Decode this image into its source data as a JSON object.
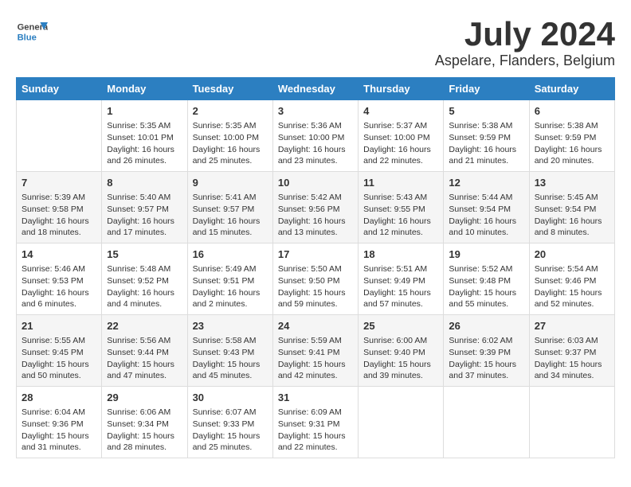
{
  "header": {
    "logo_general": "General",
    "logo_blue": "Blue",
    "month_year": "July 2024",
    "location": "Aspelare, Flanders, Belgium"
  },
  "weekdays": [
    "Sunday",
    "Monday",
    "Tuesday",
    "Wednesday",
    "Thursday",
    "Friday",
    "Saturday"
  ],
  "weeks": [
    [
      {
        "day": "",
        "content": ""
      },
      {
        "day": "1",
        "content": "Sunrise: 5:35 AM\nSunset: 10:01 PM\nDaylight: 16 hours and 26 minutes."
      },
      {
        "day": "2",
        "content": "Sunrise: 5:35 AM\nSunset: 10:00 PM\nDaylight: 16 hours and 25 minutes."
      },
      {
        "day": "3",
        "content": "Sunrise: 5:36 AM\nSunset: 10:00 PM\nDaylight: 16 hours and 23 minutes."
      },
      {
        "day": "4",
        "content": "Sunrise: 5:37 AM\nSunset: 10:00 PM\nDaylight: 16 hours and 22 minutes."
      },
      {
        "day": "5",
        "content": "Sunrise: 5:38 AM\nSunset: 9:59 PM\nDaylight: 16 hours and 21 minutes."
      },
      {
        "day": "6",
        "content": "Sunrise: 5:38 AM\nSunset: 9:59 PM\nDaylight: 16 hours and 20 minutes."
      }
    ],
    [
      {
        "day": "7",
        "content": "Sunrise: 5:39 AM\nSunset: 9:58 PM\nDaylight: 16 hours and 18 minutes."
      },
      {
        "day": "8",
        "content": "Sunrise: 5:40 AM\nSunset: 9:57 PM\nDaylight: 16 hours and 17 minutes."
      },
      {
        "day": "9",
        "content": "Sunrise: 5:41 AM\nSunset: 9:57 PM\nDaylight: 16 hours and 15 minutes."
      },
      {
        "day": "10",
        "content": "Sunrise: 5:42 AM\nSunset: 9:56 PM\nDaylight: 16 hours and 13 minutes."
      },
      {
        "day": "11",
        "content": "Sunrise: 5:43 AM\nSunset: 9:55 PM\nDaylight: 16 hours and 12 minutes."
      },
      {
        "day": "12",
        "content": "Sunrise: 5:44 AM\nSunset: 9:54 PM\nDaylight: 16 hours and 10 minutes."
      },
      {
        "day": "13",
        "content": "Sunrise: 5:45 AM\nSunset: 9:54 PM\nDaylight: 16 hours and 8 minutes."
      }
    ],
    [
      {
        "day": "14",
        "content": "Sunrise: 5:46 AM\nSunset: 9:53 PM\nDaylight: 16 hours and 6 minutes."
      },
      {
        "day": "15",
        "content": "Sunrise: 5:48 AM\nSunset: 9:52 PM\nDaylight: 16 hours and 4 minutes."
      },
      {
        "day": "16",
        "content": "Sunrise: 5:49 AM\nSunset: 9:51 PM\nDaylight: 16 hours and 2 minutes."
      },
      {
        "day": "17",
        "content": "Sunrise: 5:50 AM\nSunset: 9:50 PM\nDaylight: 15 hours and 59 minutes."
      },
      {
        "day": "18",
        "content": "Sunrise: 5:51 AM\nSunset: 9:49 PM\nDaylight: 15 hours and 57 minutes."
      },
      {
        "day": "19",
        "content": "Sunrise: 5:52 AM\nSunset: 9:48 PM\nDaylight: 15 hours and 55 minutes."
      },
      {
        "day": "20",
        "content": "Sunrise: 5:54 AM\nSunset: 9:46 PM\nDaylight: 15 hours and 52 minutes."
      }
    ],
    [
      {
        "day": "21",
        "content": "Sunrise: 5:55 AM\nSunset: 9:45 PM\nDaylight: 15 hours and 50 minutes."
      },
      {
        "day": "22",
        "content": "Sunrise: 5:56 AM\nSunset: 9:44 PM\nDaylight: 15 hours and 47 minutes."
      },
      {
        "day": "23",
        "content": "Sunrise: 5:58 AM\nSunset: 9:43 PM\nDaylight: 15 hours and 45 minutes."
      },
      {
        "day": "24",
        "content": "Sunrise: 5:59 AM\nSunset: 9:41 PM\nDaylight: 15 hours and 42 minutes."
      },
      {
        "day": "25",
        "content": "Sunrise: 6:00 AM\nSunset: 9:40 PM\nDaylight: 15 hours and 39 minutes."
      },
      {
        "day": "26",
        "content": "Sunrise: 6:02 AM\nSunset: 9:39 PM\nDaylight: 15 hours and 37 minutes."
      },
      {
        "day": "27",
        "content": "Sunrise: 6:03 AM\nSunset: 9:37 PM\nDaylight: 15 hours and 34 minutes."
      }
    ],
    [
      {
        "day": "28",
        "content": "Sunrise: 6:04 AM\nSunset: 9:36 PM\nDaylight: 15 hours and 31 minutes."
      },
      {
        "day": "29",
        "content": "Sunrise: 6:06 AM\nSunset: 9:34 PM\nDaylight: 15 hours and 28 minutes."
      },
      {
        "day": "30",
        "content": "Sunrise: 6:07 AM\nSunset: 9:33 PM\nDaylight: 15 hours and 25 minutes."
      },
      {
        "day": "31",
        "content": "Sunrise: 6:09 AM\nSunset: 9:31 PM\nDaylight: 15 hours and 22 minutes."
      },
      {
        "day": "",
        "content": ""
      },
      {
        "day": "",
        "content": ""
      },
      {
        "day": "",
        "content": ""
      }
    ]
  ]
}
